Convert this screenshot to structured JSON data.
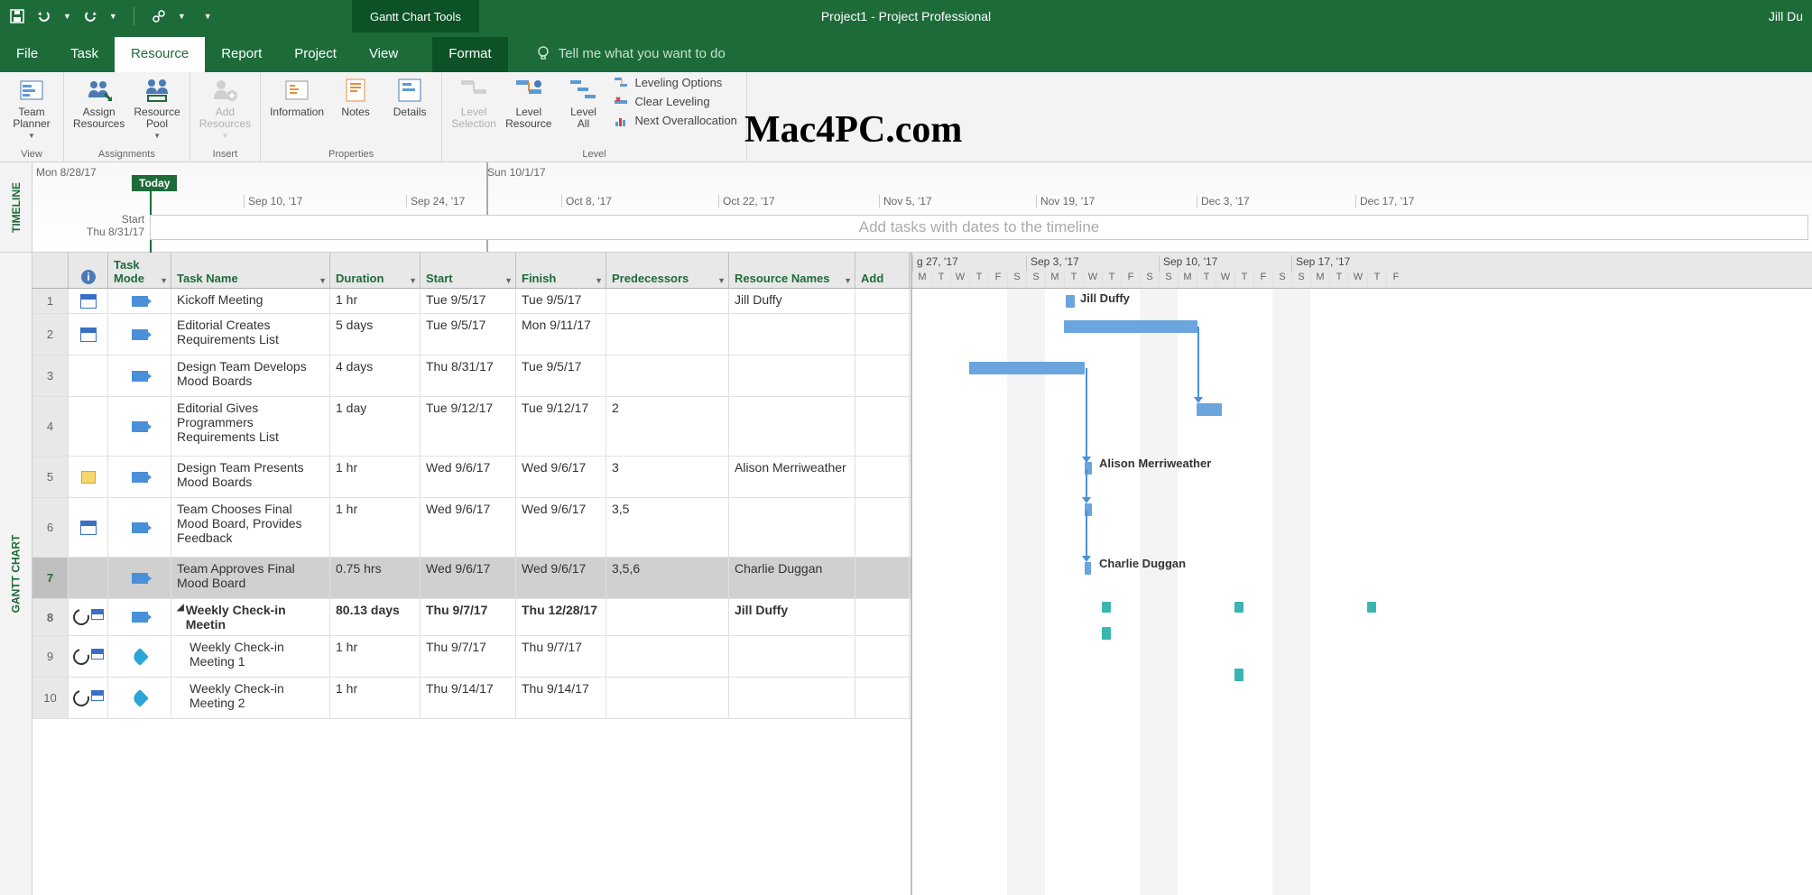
{
  "titlebar": {
    "tool_tab": "Gantt Chart Tools",
    "title": "Project1  -  Project Professional",
    "user": "Jill Du"
  },
  "tabs": {
    "file": "File",
    "task": "Task",
    "resource": "Resource",
    "report": "Report",
    "project": "Project",
    "view": "View",
    "format": "Format",
    "tellme": "Tell me what you want to do"
  },
  "ribbon": {
    "team_planner": "Team\nPlanner",
    "assign_resources": "Assign\nResources",
    "resource_pool": "Resource\nPool",
    "add_resources": "Add\nResources",
    "information": "Information",
    "notes": "Notes",
    "details": "Details",
    "level_selection": "Level\nSelection",
    "level_resource": "Level\nResource",
    "level_all": "Level\nAll",
    "leveling_options": "Leveling Options",
    "clear_leveling": "Clear Leveling",
    "next_overallocation": "Next Overallocation",
    "grp_view": "View",
    "grp_assignments": "Assignments",
    "grp_insert": "Insert",
    "grp_properties": "Properties",
    "grp_level": "Level"
  },
  "watermark": "Mac4PC.com",
  "timeline": {
    "label": "TIMELINE",
    "left_date": "Mon 8/28/17",
    "right_date": "Sun 10/1/17",
    "today": "Today",
    "start": "Start",
    "start_date": "Thu 8/31/17",
    "placeholder": "Add tasks with dates to the timeline",
    "ticks": [
      "Sep 10, '17",
      "Sep 24, '17",
      "Oct 8, '17",
      "Oct 22, '17",
      "Nov 5, '17",
      "Nov 19, '17",
      "Dec 3, '17",
      "Dec 17, '17"
    ]
  },
  "gantt_label": "GANTT CHART",
  "columns": {
    "task_mode": "Task\nMode",
    "task_name": "Task Name",
    "duration": "Duration",
    "start": "Start",
    "finish": "Finish",
    "predecessors": "Predecessors",
    "resource_names": "Resource Names",
    "add": "Add"
  },
  "weeks": [
    "g 27, '17",
    "Sep 3, '17",
    "Sep 10, '17",
    "Sep 17, '17"
  ],
  "days": "MTWTFSSMTWTFSSMTWTFSSMTWTF",
  "rows": [
    {
      "n": "1",
      "name": "Kickoff Meeting",
      "dur": "1 hr",
      "start": "Tue 9/5/17",
      "fin": "Tue 9/5/17",
      "pred": "",
      "res": "Jill Duffy",
      "i": "cal",
      "tm": "auto",
      "h": 1
    },
    {
      "n": "2",
      "name": "Editorial Creates Requirements List",
      "dur": "5 days",
      "start": "Tue 9/5/17",
      "fin": "Mon 9/11/17",
      "pred": "",
      "res": "",
      "i": "cal",
      "tm": "auto",
      "h": 2
    },
    {
      "n": "3",
      "name": "Design Team Develops Mood Boards",
      "dur": "4 days",
      "start": "Thu 8/31/17",
      "fin": "Tue 9/5/17",
      "pred": "",
      "res": "",
      "i": "",
      "tm": "auto",
      "h": 2
    },
    {
      "n": "4",
      "name": "Editorial Gives Programmers Requirements List",
      "dur": "1 day",
      "start": "Tue 9/12/17",
      "fin": "Tue 9/12/17",
      "pred": "2",
      "res": "",
      "i": "",
      "tm": "auto",
      "h": 3
    },
    {
      "n": "5",
      "name": "Design Team Presents Mood Boards",
      "dur": "1 hr",
      "start": "Wed 9/6/17",
      "fin": "Wed 9/6/17",
      "pred": "3",
      "res": "Alison Merriweather",
      "i": "note",
      "tm": "auto",
      "h": 2
    },
    {
      "n": "6",
      "name": "Team Chooses Final Mood Board, Provides Feedback",
      "dur": "1 hr",
      "start": "Wed 9/6/17",
      "fin": "Wed 9/6/17",
      "pred": "3,5",
      "res": "",
      "i": "cal",
      "tm": "auto",
      "h": 3
    },
    {
      "n": "7",
      "name": "Team Approves Final Mood Board",
      "dur": "0.75 hrs",
      "start": "Wed 9/6/17",
      "fin": "Wed 9/6/17",
      "pred": "3,5,6",
      "res": "Charlie Duggan",
      "i": "",
      "tm": "auto",
      "h": 2,
      "sel": true
    },
    {
      "n": "8",
      "name": "Weekly Check-in Meetin",
      "dur": "80.13 days",
      "start": "Thu 9/7/17",
      "fin": "Thu 12/28/17",
      "pred": "",
      "res": "Jill Duffy",
      "i": "recur",
      "tm": "auto",
      "h": 1,
      "bold": true,
      "indent": 0
    },
    {
      "n": "9",
      "name": "Weekly Check-in Meeting 1",
      "dur": "1 hr",
      "start": "Thu 9/7/17",
      "fin": "Thu 9/7/17",
      "pred": "",
      "res": "",
      "i": "recur",
      "tm": "pin",
      "h": 2
    },
    {
      "n": "10",
      "name": "Weekly Check-in Meeting 2",
      "dur": "1 hr",
      "start": "Thu 9/14/17",
      "fin": "Thu 9/14/17",
      "pred": "",
      "res": "",
      "i": "recur",
      "tm": "pin",
      "h": 2
    }
  ],
  "bar_labels": {
    "jill": "Jill Duffy",
    "alison": "Alison Merriweather",
    "charlie": "Charlie Duggan"
  }
}
